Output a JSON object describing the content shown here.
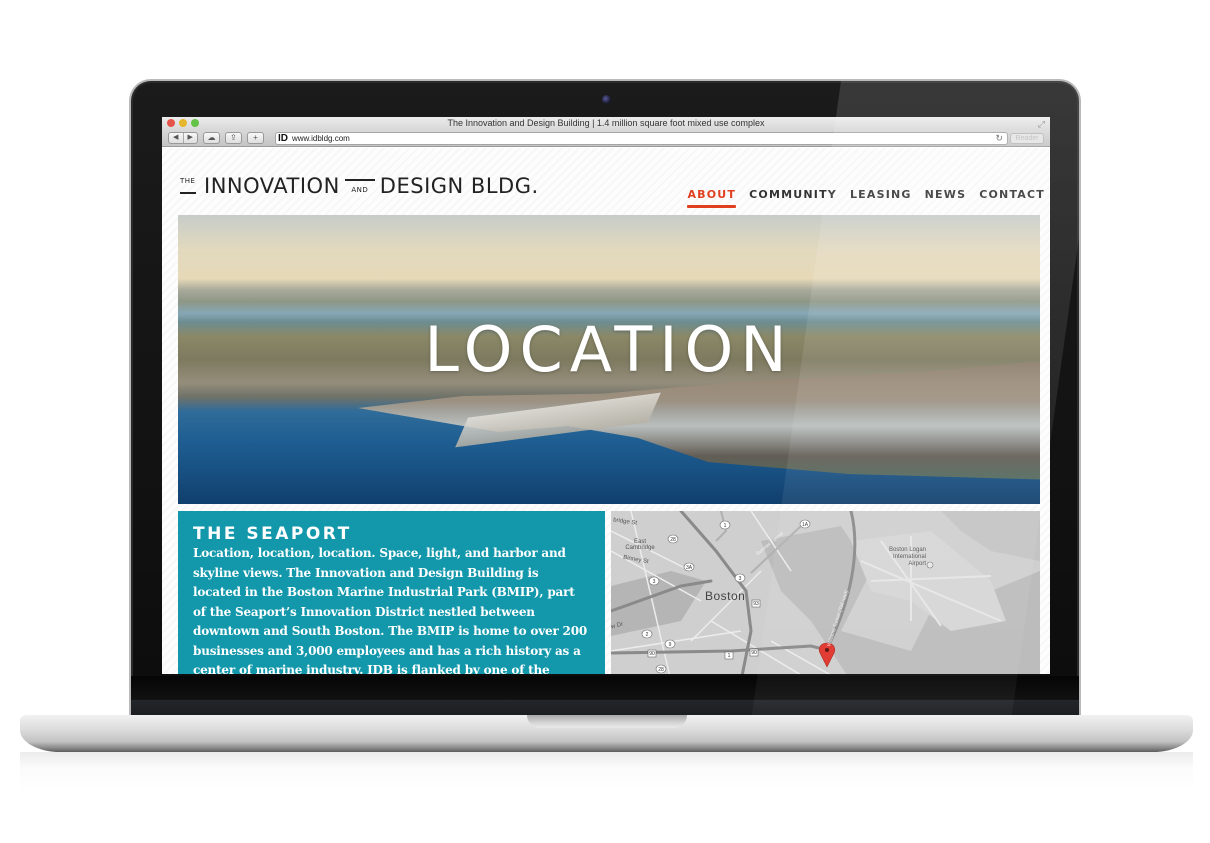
{
  "browser": {
    "window_title": "The Innovation and Design Building | 1.4 million square foot mixed use complex",
    "url": "www.idbldg.com",
    "favicon_text": "ID",
    "back_glyph": "◀",
    "forward_glyph": "▶",
    "icloud_glyph": "☁",
    "share_glyph": "⇪",
    "add_glyph": "+",
    "reload_glyph": "↻",
    "reader_label": "Reader",
    "fullscreen_glyph": "⤢"
  },
  "site": {
    "logo": {
      "the": "THE",
      "word1": "INNOVATION",
      "and": "AND",
      "word2": "DESIGN BLDG."
    },
    "nav": [
      {
        "label": "ABOUT",
        "active": true
      },
      {
        "label": "COMMUNITY",
        "active": false
      },
      {
        "label": "LEASING",
        "active": false
      },
      {
        "label": "NEWS",
        "active": false
      },
      {
        "label": "CONTACT",
        "active": false
      }
    ],
    "hero": {
      "title": "LOCATION"
    },
    "seaport": {
      "heading": "THE SEAPORT",
      "body": "Location, location, location. Space, light, and harbor and skyline views. The Innovation and Design Building is located in the Boston Marine Industrial Park (BMIP), part of the Seaport’s Innovation District nestled between downtown and South Boston. The BMIP is home to over 200 businesses and 3,000 employees and has a rich history as a center of marine industry. IDB is flanked by one of the country’s largest working dry docks to the north and by the Black"
    },
    "map": {
      "labels": {
        "city": "Boston",
        "east_cambridge": "East Cambridge",
        "cambridge_st": "bridge St",
        "binney_st": "Binney St",
        "airport": "Boston Logan International Airport",
        "sumner_tunnel": "Sumner Tunnel",
        "toll_road": "Williams Tunnel (Toll road)",
        "dr": "w Dr"
      },
      "route_shields": [
        "1",
        "28",
        "3A",
        "3",
        "3",
        "93",
        "2",
        "9",
        "1A",
        "90",
        "1",
        "90",
        "28"
      ]
    },
    "colors": {
      "accent": "#e0401f",
      "seaport_bg": "#1398ab",
      "pin": "#e0332a"
    }
  }
}
